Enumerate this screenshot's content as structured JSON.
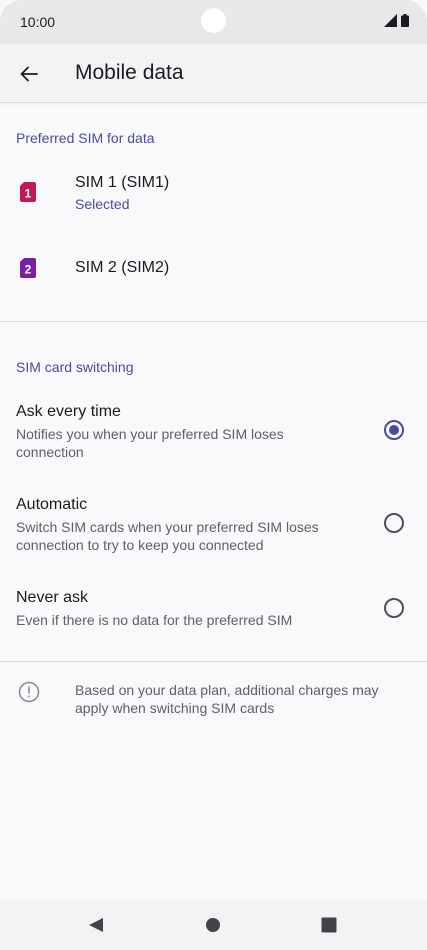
{
  "status_bar": {
    "time": "10:00"
  },
  "app_bar": {
    "title": "Mobile data"
  },
  "preferred_sim": {
    "header": "Preferred SIM for data",
    "items": [
      {
        "number": "1",
        "title": "SIM 1 (SIM1)",
        "subtitle": "Selected",
        "color": "#c2185b"
      },
      {
        "number": "2",
        "title": "SIM 2 (SIM2)",
        "subtitle": "",
        "color": "#7b1fa2"
      }
    ]
  },
  "switching": {
    "header": "SIM card switching",
    "options": [
      {
        "title": "Ask every time",
        "description": "Notifies you when your preferred SIM loses connection",
        "selected": true
      },
      {
        "title": "Automatic",
        "description": "Switch SIM cards when your preferred SIM loses connection to try to keep you connected",
        "selected": false
      },
      {
        "title": "Never ask",
        "description": "Even if there is no data for the preferred SIM",
        "selected": false
      }
    ]
  },
  "info": {
    "text": "Based on your data plan, additional charges may apply when switching SIM cards"
  },
  "nav": {
    "back": "back-triangle",
    "home": "home-circle",
    "recents": "recents-square"
  },
  "colors": {
    "accent": "#4a4aa0",
    "sim1": "#c2185b",
    "sim2": "#7b1fa2"
  }
}
